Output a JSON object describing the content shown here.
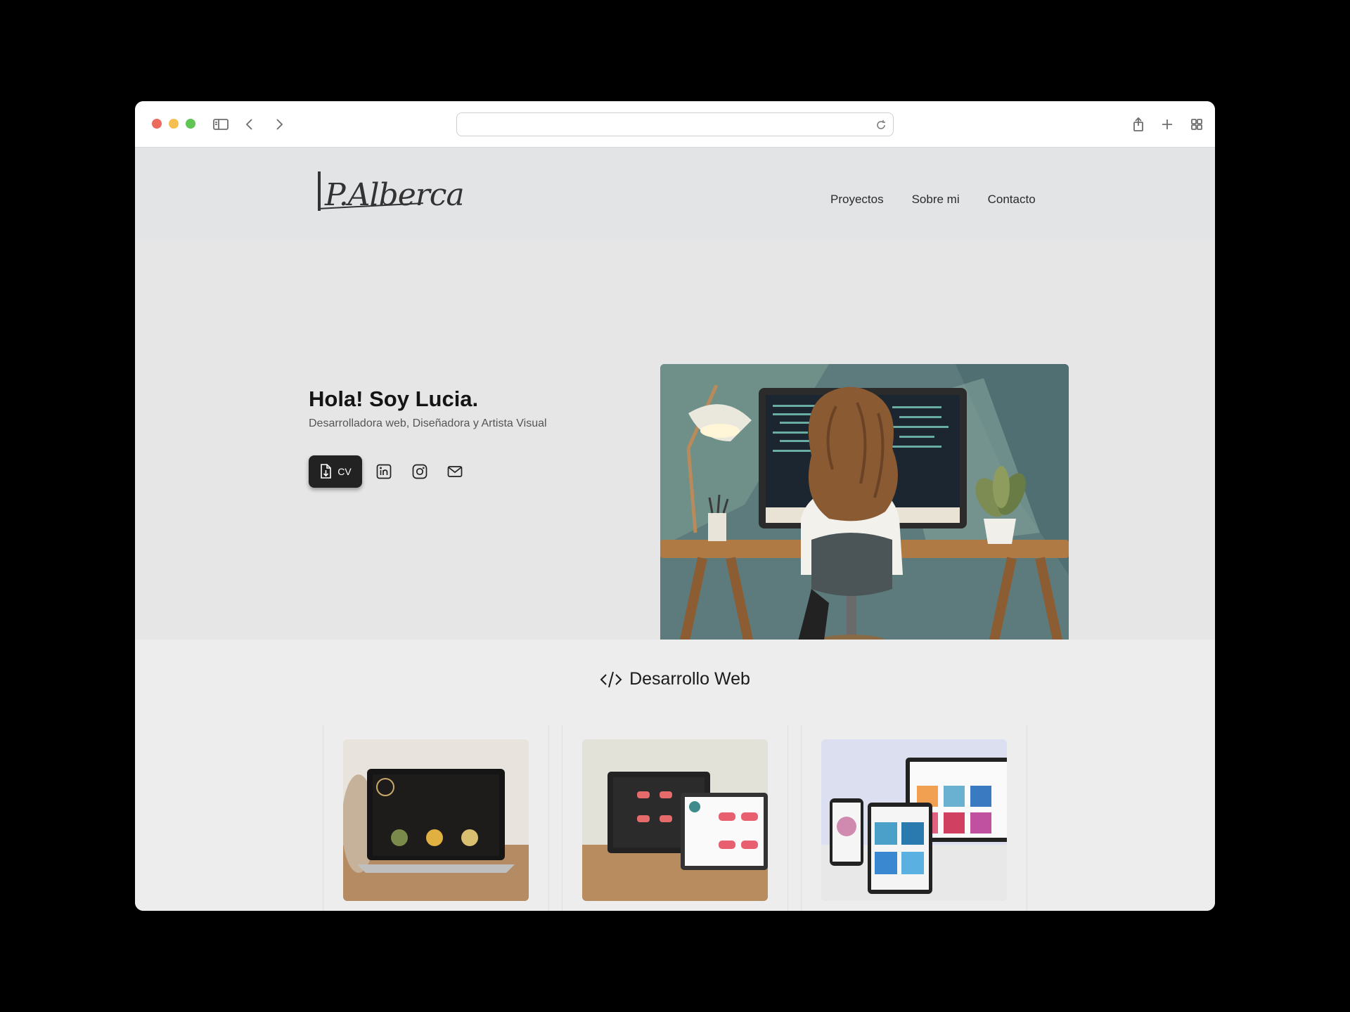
{
  "browser": {
    "address_value": "",
    "icons": [
      "sidebar-icon",
      "back-icon",
      "forward-icon",
      "reload-icon",
      "share-icon",
      "new-tab-icon",
      "tab-overview-icon"
    ]
  },
  "site": {
    "logo_text": "P.Alberca",
    "nav": [
      "Proyectos",
      "Sobre mi",
      "Contacto"
    ]
  },
  "hero": {
    "title": "Hola! Soy Lucia.",
    "subtitle": "Desarrolladora web, Diseñadora y Artista Visual",
    "cv_label": "CV",
    "social_icons": [
      "linkedin-icon",
      "instagram-icon",
      "mail-icon"
    ]
  },
  "section": {
    "title": "Desarrollo Web"
  },
  "colors": {
    "accent_dark": "#222222",
    "hero_bg": "#e6e6e7",
    "section_bg": "#ededee"
  }
}
